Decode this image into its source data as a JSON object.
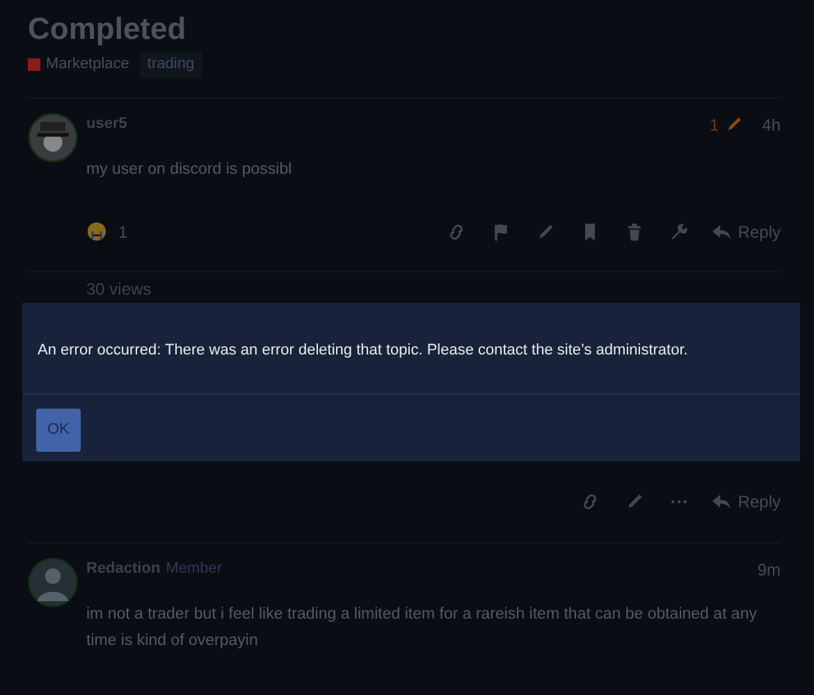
{
  "topic": {
    "title": "Completed",
    "category": {
      "name": "Marketplace",
      "color": "#8b1a1a"
    },
    "tags": [
      "trading"
    ]
  },
  "posts": [
    {
      "author": "user5",
      "edits": "1",
      "time": "4h",
      "avatar": {
        "kind": "skull"
      },
      "text": "my user on discord is possibl",
      "reaction": {
        "count": "1"
      },
      "actions": [
        {
          "kind": "link"
        },
        {
          "kind": "flag"
        },
        {
          "kind": "edit"
        },
        {
          "kind": "bookmark"
        },
        {
          "kind": "delete"
        },
        {
          "kind": "wrench"
        }
      ],
      "reply": "Reply",
      "views": "30 views"
    },
    {
      "actions": [
        {
          "kind": "link"
        },
        {
          "kind": "edit"
        },
        {
          "kind": "more"
        }
      ],
      "reply": "Reply"
    },
    {
      "author": "Redaction",
      "role": "Member",
      "time": "9m",
      "avatar": {
        "kind": "figure"
      },
      "text": "im not a trader but i feel like trading a limited item for a rareish item that can be obtained at any time is kind of overpayin"
    }
  ],
  "dialog": {
    "message": "An error occurred: There was an error deleting that topic. Please contact the site’s administrator.",
    "button": "OK"
  }
}
